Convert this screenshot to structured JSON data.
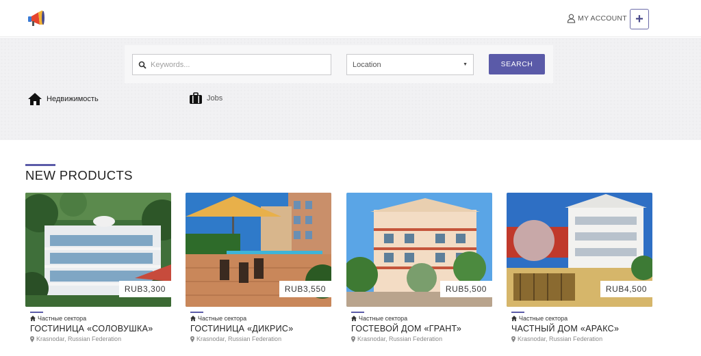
{
  "header": {
    "account_label": "MY ACCOUNT",
    "add_label": "+"
  },
  "search": {
    "keywords_placeholder": "Keywords...",
    "location_value": "Location",
    "button_label": "SEARCH"
  },
  "categories": [
    {
      "label": "Недвижимость",
      "icon": "home-icon"
    },
    {
      "label": "Jobs",
      "icon": "briefcase-icon"
    }
  ],
  "section": {
    "title": "NEW PRODUCTS"
  },
  "products": [
    {
      "price": "RUB3,300",
      "category": "Частные сектора",
      "title": "ГОСТИНИЦА «СОЛОВУШКА»",
      "location": "Krasnodar, Russian Federation"
    },
    {
      "price": "RUB3,550",
      "category": "Частные сектора",
      "title": "ГОСТИНИЦА «ДИКРИС»",
      "location": "Krasnodar, Russian Federation"
    },
    {
      "price": "RUB5,500",
      "category": "Частные сектора",
      "title": "ГОСТЕВОЙ ДОМ «ГРАНТ»",
      "location": "Krasnodar, Russian Federation"
    },
    {
      "price": "RUB4,500",
      "category": "Частные сектора",
      "title": "ЧАСТНЫЙ ДОМ «АРАКС»",
      "location": "Krasnodar, Russian Federation"
    }
  ],
  "colors": {
    "accent": "#5a5aa8",
    "hero_bg": "#f1f1f3"
  }
}
